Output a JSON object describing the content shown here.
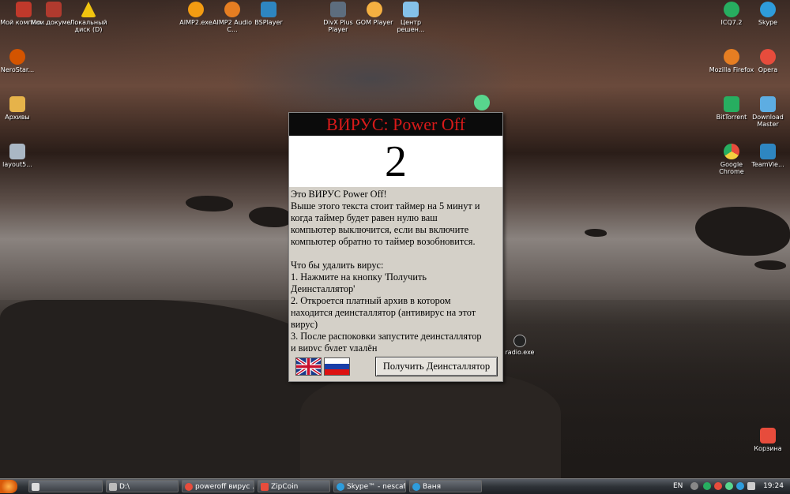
{
  "desktop": {
    "icons_left": [
      {
        "label": "Мой компью...",
        "icon": "my-computer-icon",
        "color": "#c0392b"
      },
      {
        "label": "Мои докуме...",
        "icon": "my-documents-icon",
        "color": "#b03a2e"
      },
      {
        "label": "Локальный диск (D)",
        "icon": "warning-disk-icon",
        "color": "#f1c40f"
      }
    ],
    "icons_left_col": [
      {
        "label": "NeroStar...",
        "icon": "nero-icon",
        "color": "#d35400"
      },
      {
        "label": "Архивы",
        "icon": "folder-icon",
        "color": "#e6b34a"
      },
      {
        "label": "layout5...",
        "icon": "layout-icon",
        "color": "#aab7c4"
      }
    ],
    "icons_top": [
      {
        "label": "AIMP2.exe",
        "icon": "aimp-icon",
        "color": "#f39c12"
      },
      {
        "label": "AIMP2 Audio C...",
        "icon": "aimp-audio-icon",
        "color": "#e67e22"
      },
      {
        "label": "BSPlayer",
        "icon": "bsplayer-icon",
        "color": "#2e86c1"
      },
      {
        "label": "DivX Plus Player",
        "icon": "divx-icon",
        "color": "#5d6d7e"
      },
      {
        "label": "GOM Player",
        "icon": "gom-icon",
        "color": "#f5b041"
      },
      {
        "label": "Центр решен...",
        "icon": "help-center-icon",
        "color": "#85c1e9"
      }
    ],
    "icons_right": [
      {
        "label": "ICQ7.2",
        "icon": "icq-icon",
        "color": "#27ae60"
      },
      {
        "label": "Skype",
        "icon": "skype-icon",
        "color": "#2e9cdb"
      },
      {
        "label": "Mozilla Firefox",
        "icon": "firefox-icon",
        "color": "#e67e22"
      },
      {
        "label": "Opera",
        "icon": "opera-icon",
        "color": "#e74c3c"
      },
      {
        "label": "BitTorrent",
        "icon": "bittorrent-icon",
        "color": "#27ae60"
      },
      {
        "label": "Download Master",
        "icon": "download-master-icon",
        "color": "#5dade2"
      },
      {
        "label": "Google Chrome",
        "icon": "chrome-icon",
        "color": "#f4d03f"
      },
      {
        "label": "TeamVie...",
        "icon": "teamviewer-icon",
        "color": "#2e86c1"
      },
      {
        "label": "Корзина",
        "icon": "recycle-bin-icon",
        "color": "#e74c3c"
      }
    ],
    "stray_label": "radio.exe"
  },
  "dialog": {
    "title": "ВИРУС: Power Off",
    "timer": "2",
    "body_lines": [
      "Это ВИРУС Power Off!",
      "Выше этого текста стоит таймер на 5 минут и",
      "когда таймер будет равен нулю ваш",
      "компьютер выключится, если вы включите",
      "компьютер обратно то таймер возобновится.",
      "",
      "Что бы удалить вирус:",
      "1. Нажмите на кнопку 'Получить",
      "Деинсталлятор'",
      "2. Откроется платный архив в котором",
      "находится деинсталлятор (антивирус на этот",
      "вирус)",
      "3. После распоковки запустите деинсталлятор",
      "и вирус будет удалён"
    ],
    "flag_en": "uk-flag-icon",
    "flag_ru": "ru-flag-icon",
    "button_label": "Получить Деинсталлятор"
  },
  "taskbar": {
    "items": [
      {
        "label": "",
        "icon": "show-desktop-icon",
        "color": "#ddd"
      },
      {
        "label": "D:\\",
        "icon": "drive-icon",
        "color": "#bbb"
      },
      {
        "label": "poweroff вирус ...",
        "icon": "opera-icon",
        "color": "#e74c3c"
      },
      {
        "label": "ZipCoin",
        "icon": "zip-icon",
        "color": "#e74c3c"
      },
      {
        "label": "Skype™ - nescaf...",
        "icon": "skype-icon",
        "color": "#2e9cdb"
      },
      {
        "label": "Ваня",
        "icon": "skype-chat-icon",
        "color": "#2e9cdb"
      }
    ],
    "language": "EN",
    "clock": "19:24"
  }
}
